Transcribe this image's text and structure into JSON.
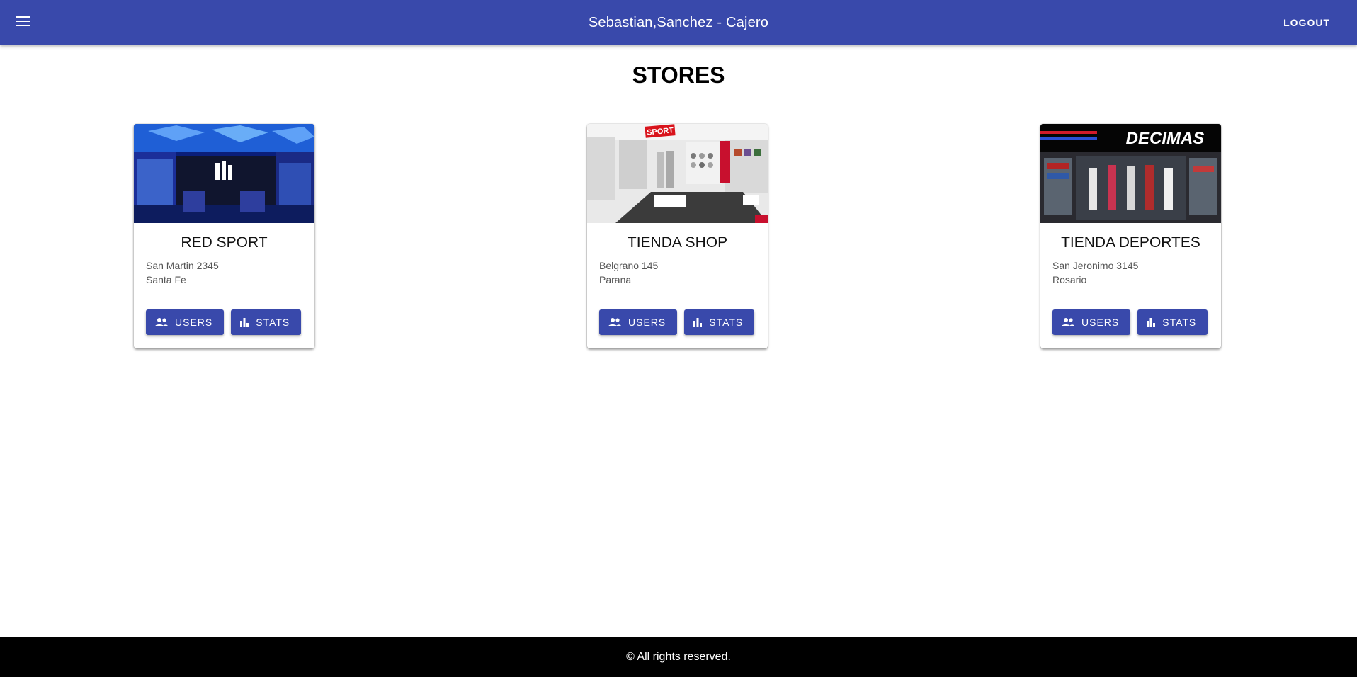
{
  "header": {
    "title": "Sebastian,Sanchez - Cajero",
    "logout_label": "LOGOUT"
  },
  "page": {
    "heading": "STORES"
  },
  "stores": [
    {
      "name": "RED SPORT",
      "address": "San Martin 2345",
      "city": "Santa Fe",
      "users_label": "USERS",
      "stats_label": "STATS"
    },
    {
      "name": "TIENDA SHOP",
      "address": "Belgrano 145",
      "city": "Parana",
      "users_label": "USERS",
      "stats_label": "STATS",
      "photo_text": "SPORT"
    },
    {
      "name": "TIENDA DEPORTES",
      "address": "San Jeronimo 3145",
      "city": "Rosario",
      "users_label": "USERS",
      "stats_label": "STATS",
      "photo_text": "DECIMAS"
    }
  ],
  "footer": {
    "text": "© All rights reserved."
  },
  "colors": {
    "primary": "#3949ab",
    "footer_bg": "#000000"
  },
  "icons": {
    "menu": "menu-icon",
    "users": "people-icon",
    "stats": "bar-chart-icon"
  }
}
